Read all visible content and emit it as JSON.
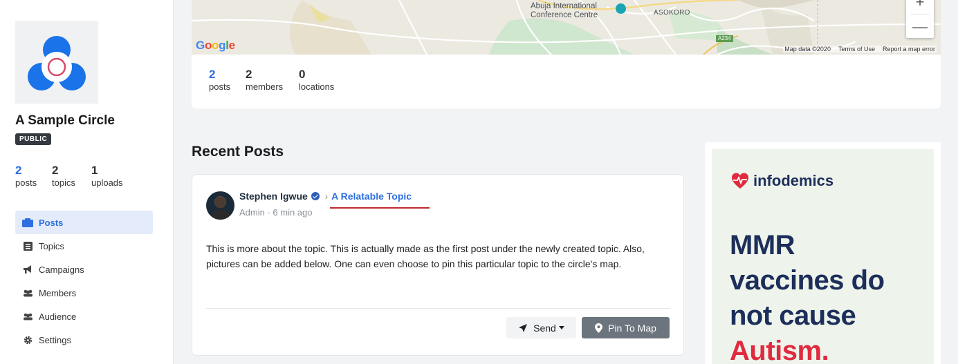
{
  "circle": {
    "name": "A Sample Circle",
    "visibility": "PUBLIC",
    "stats": [
      {
        "value": "2",
        "label": "posts"
      },
      {
        "value": "2",
        "label": "topics"
      },
      {
        "value": "1",
        "label": "uploads"
      }
    ]
  },
  "sidebar": {
    "items": [
      {
        "label": "Posts",
        "icon": "posts-icon",
        "active": true
      },
      {
        "label": "Topics",
        "icon": "topics-icon"
      },
      {
        "label": "Campaigns",
        "icon": "megaphone-icon"
      },
      {
        "label": "Members",
        "icon": "members-icon"
      },
      {
        "label": "Audience",
        "icon": "audience-icon"
      },
      {
        "label": "Settings",
        "icon": "gear-icon"
      }
    ]
  },
  "map": {
    "labels": {
      "abuja_line1": "Abuja International",
      "abuja_line2": "Conference Centre",
      "asokoro": "ASOKORO",
      "road": "A234"
    },
    "google": "Google",
    "footer": {
      "data": "Map data ©2020",
      "terms": "Terms of Use",
      "report": "Report a map error"
    },
    "zoom_in": "+",
    "zoom_out": "—",
    "stats": [
      {
        "value": "2",
        "label": "posts"
      },
      {
        "value": "2",
        "label": "members"
      },
      {
        "value": "0",
        "label": "locations"
      }
    ]
  },
  "recent_posts": {
    "title": "Recent Posts",
    "post": {
      "author": "Stephen Igwue",
      "separator": "›",
      "topic": "A Relatable Topic",
      "meta": "Admin · 6 min ago",
      "body": "This is more about the topic. This is actually made as the first post under the newly created topic. Also, pictures can be added below. One can even choose to pin this particular topic to the circle's map.",
      "send_label": "Send",
      "pin_label": "Pin To Map"
    }
  },
  "ad": {
    "brand": "infodemics",
    "line1": "MMR",
    "line2": "vaccines do",
    "line3": "not cause",
    "line4": "Autism."
  },
  "colors": {
    "accent": "#2d6fe0",
    "badge": "#343a40",
    "ad_navy": "#1d2e5a",
    "ad_red": "#e02a3f",
    "topic_underline": "#c0272d"
  }
}
